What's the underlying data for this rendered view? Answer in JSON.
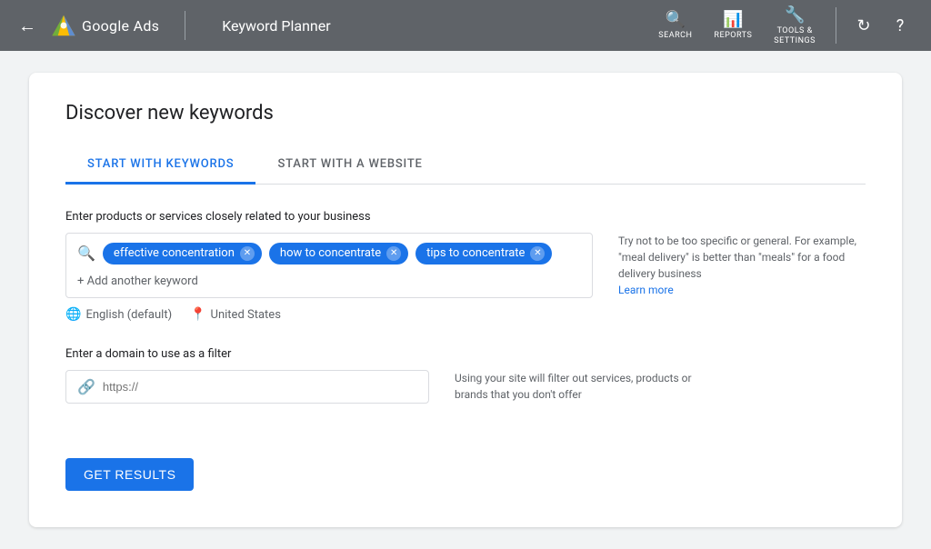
{
  "nav": {
    "back_label": "←",
    "google_ads_label": "Google Ads",
    "divider": "|",
    "page_title": "Keyword Planner",
    "icons": [
      {
        "id": "search",
        "symbol": "🔍",
        "label": "SEARCH"
      },
      {
        "id": "reports",
        "symbol": "📊",
        "label": "REPORTS"
      },
      {
        "id": "tools",
        "symbol": "🔧",
        "label": "TOOLS &\nSETTINGS"
      }
    ],
    "refresh_label": "↻",
    "help_label": "?"
  },
  "card": {
    "title": "Discover new keywords",
    "tabs": [
      {
        "id": "keywords",
        "label": "START WITH KEYWORDS",
        "active": true
      },
      {
        "id": "website",
        "label": "START WITH A WEBSITE",
        "active": false
      }
    ],
    "keywords_section": {
      "label": "Enter products or services closely related to your business",
      "chips": [
        {
          "id": "chip1",
          "text": "effective concentration"
        },
        {
          "id": "chip2",
          "text": "how to concentrate"
        },
        {
          "id": "chip3",
          "text": "tips to concentrate"
        }
      ],
      "add_placeholder": "+ Add another keyword",
      "hint_text": "Try not to be too specific or general. For example, \"meal delivery\" is better than \"meals\" for a food delivery business",
      "hint_link": "Learn more"
    },
    "lang_row": {
      "lang_icon": "🌐",
      "lang_text": "English (default)",
      "location_icon": "📍",
      "location_text": "United States"
    },
    "domain_section": {
      "label": "Enter a domain to use as a filter",
      "placeholder": "https://",
      "hint_text": "Using your site will filter out services, products or brands that you don't offer"
    },
    "submit_button": "GET RESULTS"
  }
}
